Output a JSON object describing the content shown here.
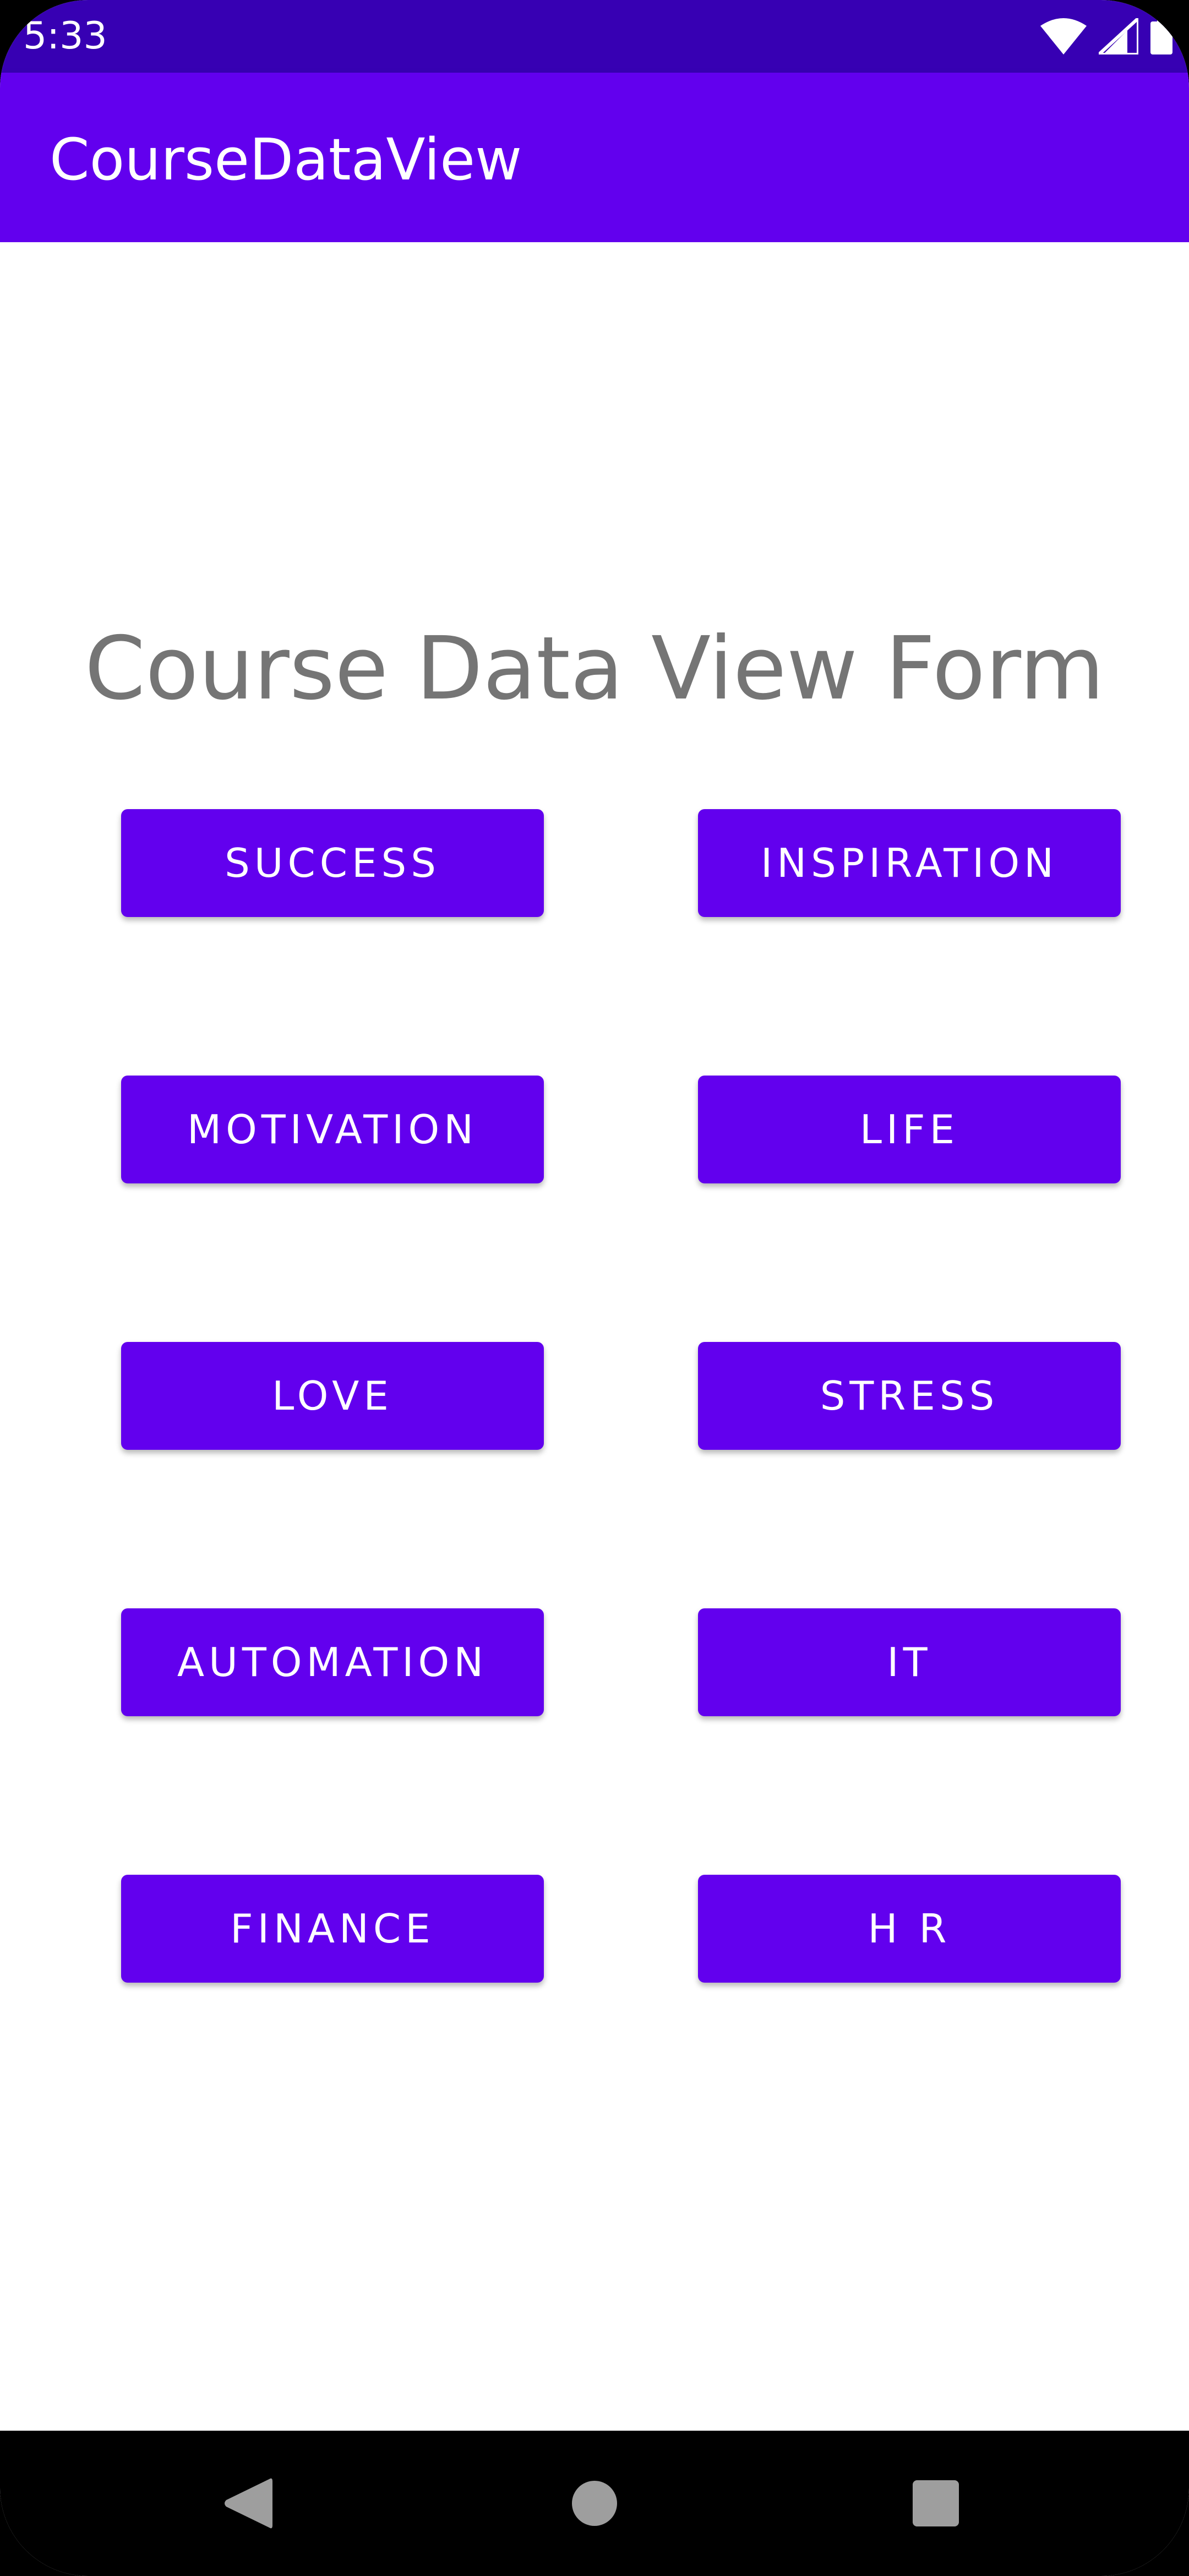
{
  "status_bar": {
    "time": "5:33",
    "icons": [
      "wifi-icon",
      "signal-icon",
      "battery-icon"
    ]
  },
  "app_bar": {
    "title": "CourseDataView"
  },
  "form": {
    "title": "Course Data View Form",
    "buttons": [
      {
        "label": "SUCCESS"
      },
      {
        "label": "INSPIRATION"
      },
      {
        "label": "MOTIVATION"
      },
      {
        "label": "LIFE"
      },
      {
        "label": "LOVE"
      },
      {
        "label": "STRESS"
      },
      {
        "label": "AUTOMATION"
      },
      {
        "label": "IT"
      },
      {
        "label": "FINANCE"
      },
      {
        "label": "H R"
      }
    ]
  },
  "nav_bar": {
    "icons": [
      "back-icon",
      "home-icon",
      "recents-icon"
    ]
  },
  "colors": {
    "status_bar": "#3700b3",
    "app_bar": "#6200ee",
    "button": "#6200ee",
    "title_text": "#757575"
  }
}
